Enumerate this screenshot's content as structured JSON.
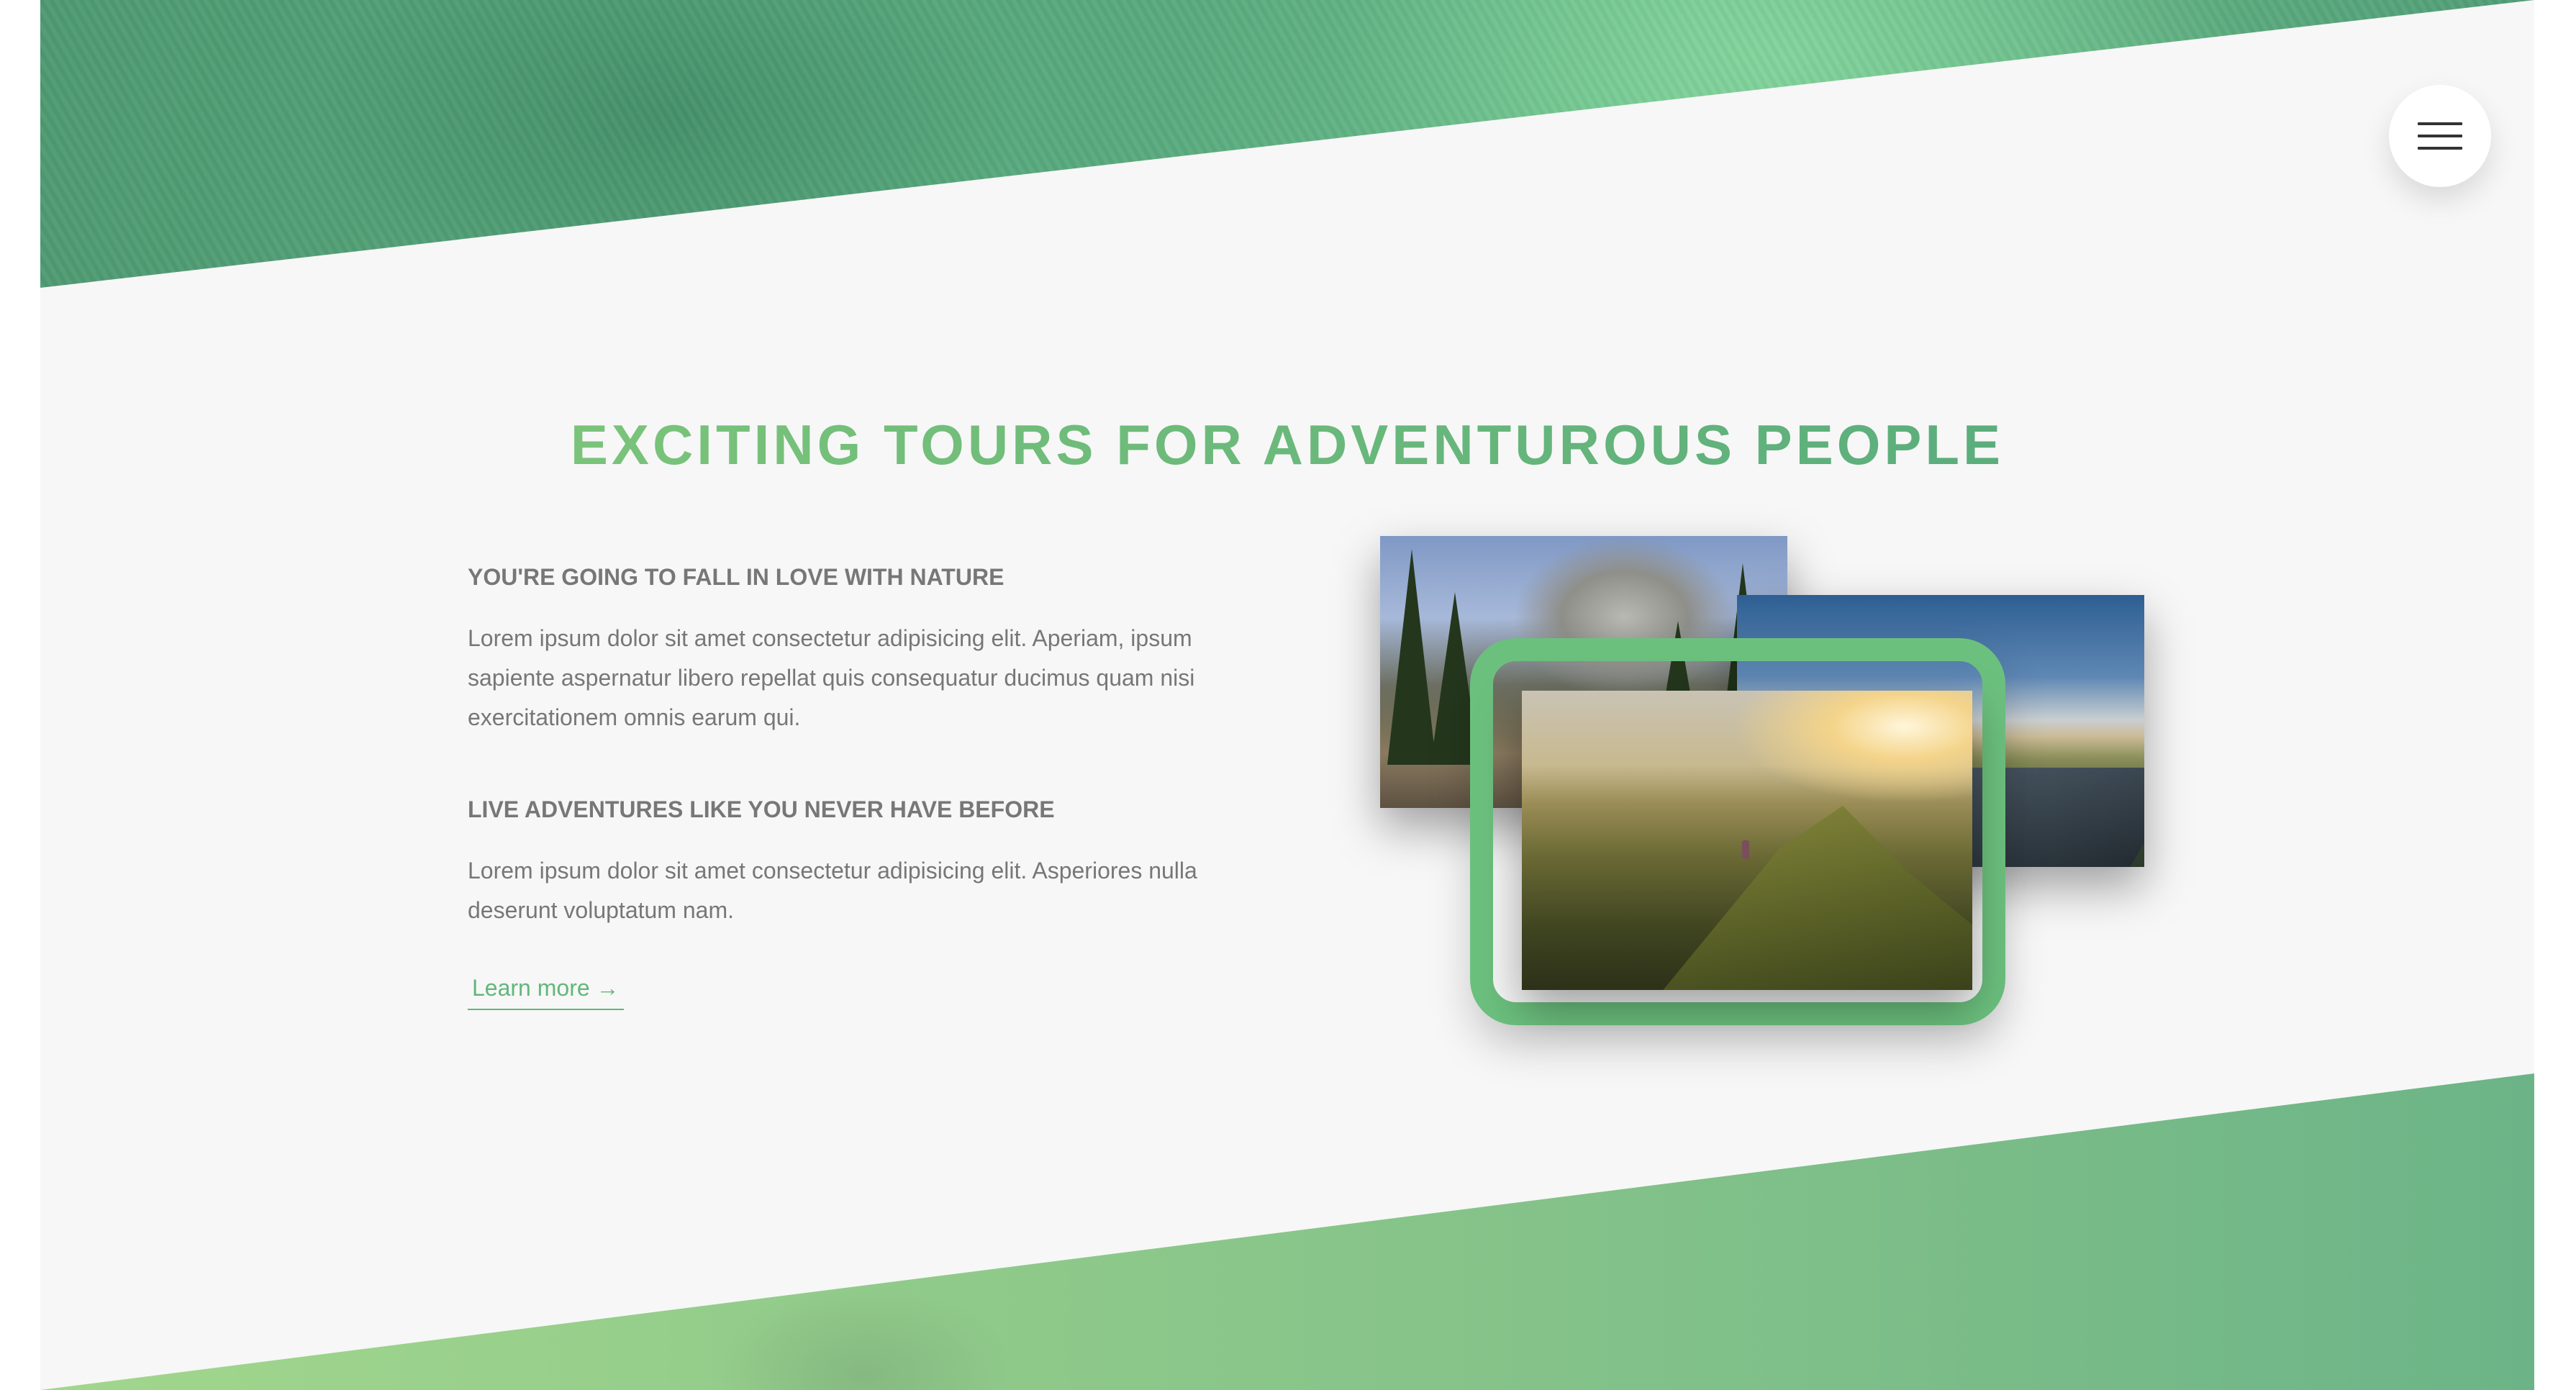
{
  "section": {
    "title": "EXCITING TOURS FOR ADVENTUROUS PEOPLE"
  },
  "menu": {
    "icon": "hamburger-menu-icon"
  },
  "content": {
    "heading_1": "YOU'RE GOING TO FALL IN LOVE WITH NATURE",
    "paragraph_1": "Lorem ipsum dolor sit amet consectetur adipisicing elit. Aperiam, ipsum sapiente aspernatur libero repellat quis consequatur ducimus quam nisi exercitationem omnis earum qui.",
    "heading_2": "LIVE ADVENTURES LIKE YOU NEVER HAVE BEFORE",
    "paragraph_2": "Lorem ipsum dolor sit amet consectetur adipisicing elit. Asperiores nulla deserunt voluptatum nam.",
    "link_label": "Learn more →"
  },
  "colors": {
    "accent_green": "#6cc07e",
    "title_gradient_start": "#86cb79",
    "title_gradient_end": "#4fa67d",
    "text_gray": "#777777",
    "background": "#f7f7f7"
  }
}
